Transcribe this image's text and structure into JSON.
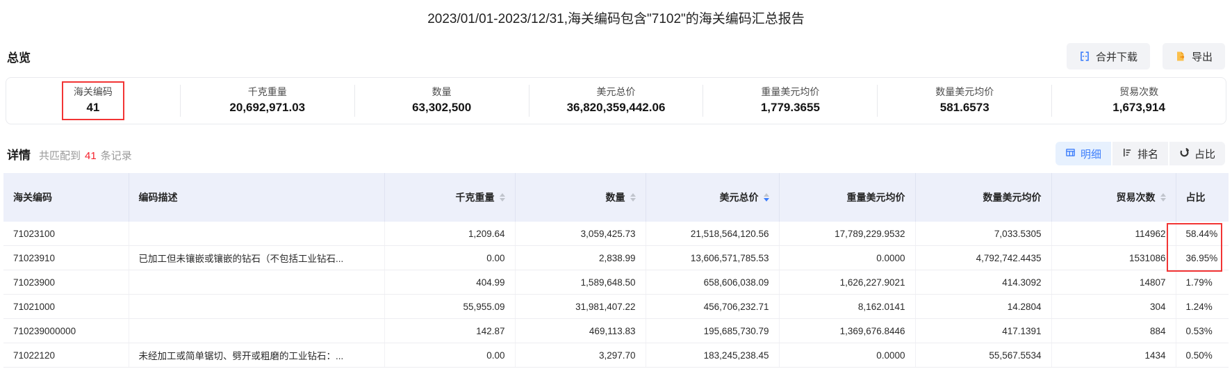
{
  "title": "2023/01/01-2023/12/31,海关编码包含\"7102\"的海关编码汇总报告",
  "colors": {
    "accent_blue": "#3d7efb",
    "annotation_red": "#f23434",
    "count_red": "#f5222d",
    "export_orange": "#f7a926",
    "header_band": "#edf0fa"
  },
  "overview": {
    "section_title": "总览",
    "buttons": {
      "merge_download": "合并下载",
      "export": "导出"
    },
    "stats": [
      {
        "label": "海关编码",
        "value": "41",
        "highlighted": true
      },
      {
        "label": "千克重量",
        "value": "20,692,971.03"
      },
      {
        "label": "数量",
        "value": "63,302,500"
      },
      {
        "label": "美元总价",
        "value": "36,820,359,442.06"
      },
      {
        "label": "重量美元均价",
        "value": "1,779.3655"
      },
      {
        "label": "数量美元均价",
        "value": "581.6573"
      },
      {
        "label": "贸易次数",
        "value": "1,673,914"
      }
    ]
  },
  "detail": {
    "section_title": "详情",
    "match_prefix": "共匹配到",
    "match_count": "41",
    "match_suffix": "条记录",
    "view_buttons": [
      {
        "label": "明细",
        "icon": "table-icon",
        "active": true
      },
      {
        "label": "排名",
        "icon": "ranking-icon",
        "active": false
      },
      {
        "label": "占比",
        "icon": "pie-chart-icon",
        "active": false
      }
    ]
  },
  "table": {
    "columns": [
      {
        "label": "海关编码",
        "sortable": false
      },
      {
        "label": "编码描述",
        "sortable": false
      },
      {
        "label": "千克重量",
        "sortable": true
      },
      {
        "label": "数量",
        "sortable": true
      },
      {
        "label": "美元总价",
        "sortable": true,
        "sort": "desc"
      },
      {
        "label": "重量美元均价",
        "sortable": false
      },
      {
        "label": "数量美元均价",
        "sortable": false
      },
      {
        "label": "贸易次数",
        "sortable": true
      },
      {
        "label": "占比",
        "sortable": false
      }
    ],
    "rows": [
      [
        "71023100",
        "",
        "1,209.64",
        "3,059,425.73",
        "21,518,564,120.56",
        "17,789,229.9532",
        "7,033.5305",
        "114962",
        "58.44%"
      ],
      [
        "71023910",
        "已加工但未镶嵌或镶嵌的钻石（不包括工业钻石...",
        "0.00",
        "2,838.99",
        "13,606,571,785.53",
        "0.0000",
        "4,792,742.4435",
        "1531086",
        "36.95%"
      ],
      [
        "71023900",
        "",
        "404.99",
        "1,589,648.50",
        "658,606,038.09",
        "1,626,227.9021",
        "414.3092",
        "14807",
        "1.79%"
      ],
      [
        "71021000",
        "",
        "55,955.09",
        "31,981,407.22",
        "456,706,232.71",
        "8,162.0141",
        "14.2804",
        "304",
        "1.24%"
      ],
      [
        "710239000000",
        "",
        "142.87",
        "469,113.83",
        "195,685,730.79",
        "1,369,676.8446",
        "417.1391",
        "884",
        "0.53%"
      ],
      [
        "71022120",
        "未经加工或简单锯切、劈开或粗磨的工业钻石：...",
        "0.00",
        "3,297.70",
        "183,245,238.45",
        "0.0000",
        "55,567.5534",
        "1434",
        "0.50%"
      ]
    ],
    "highlighted_ratio_rows": [
      0,
      1
    ]
  }
}
